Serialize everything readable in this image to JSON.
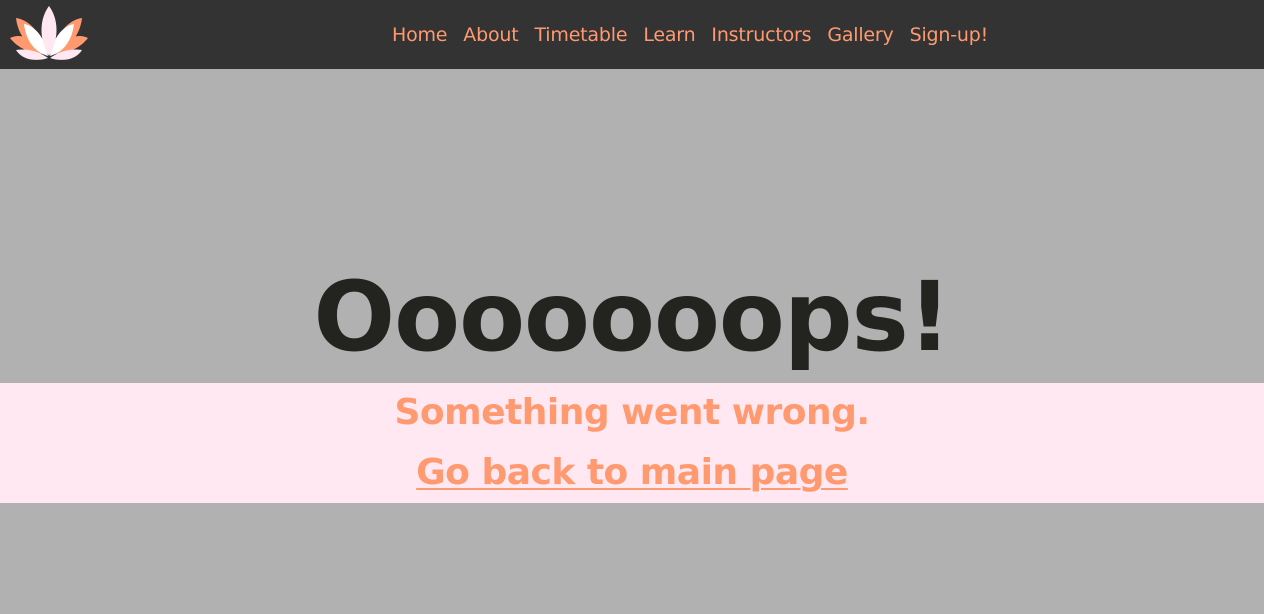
{
  "nav": {
    "logo_icon": "lotus-icon",
    "links": [
      {
        "label": "Home"
      },
      {
        "label": "About"
      },
      {
        "label": "Timetable"
      },
      {
        "label": "Learn"
      },
      {
        "label": "Instructors"
      },
      {
        "label": "Gallery"
      },
      {
        "label": "Sign-up!"
      }
    ]
  },
  "error": {
    "heading": "Ooooooops!",
    "message": "Something went wrong.",
    "back_link": "Go back to main page"
  },
  "colors": {
    "navbar_bg": "#333333",
    "accent": "#ff9a70",
    "page_bg": "#b1b1b1",
    "band_bg": "#ffe8f2",
    "heading": "#23231f"
  }
}
